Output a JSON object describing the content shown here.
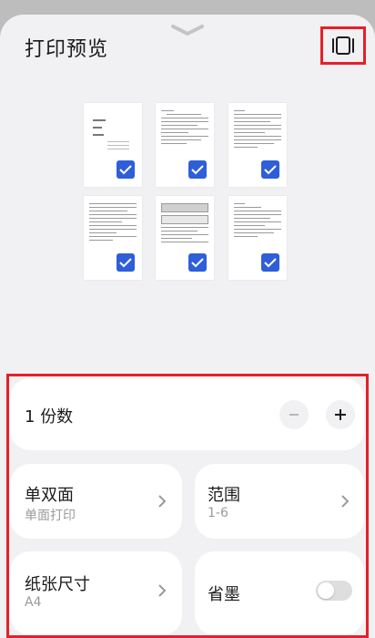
{
  "header": {
    "title": "打印预览",
    "layout_icon": "page-layout-icon",
    "handle_icon": "chevron-down-icon"
  },
  "preview": {
    "pages": [
      {
        "page": 1,
        "checked": true
      },
      {
        "page": 2,
        "checked": true
      },
      {
        "page": 3,
        "checked": true
      },
      {
        "page": 4,
        "checked": true
      },
      {
        "page": 5,
        "checked": true
      },
      {
        "page": 6,
        "checked": true
      }
    ]
  },
  "settings": {
    "copies": {
      "value": "1",
      "label": "份数"
    },
    "duplex": {
      "label": "单双面",
      "value": "单面打印"
    },
    "range": {
      "label": "范围",
      "value": "1-6"
    },
    "paper": {
      "label": "纸张尺寸",
      "value": "A4"
    },
    "ink_save": {
      "label": "省墨",
      "enabled": false
    }
  },
  "colors": {
    "accent": "#2e5fd8",
    "highlight_border": "#e4202a",
    "sheet_bg": "#f1f1f3"
  }
}
